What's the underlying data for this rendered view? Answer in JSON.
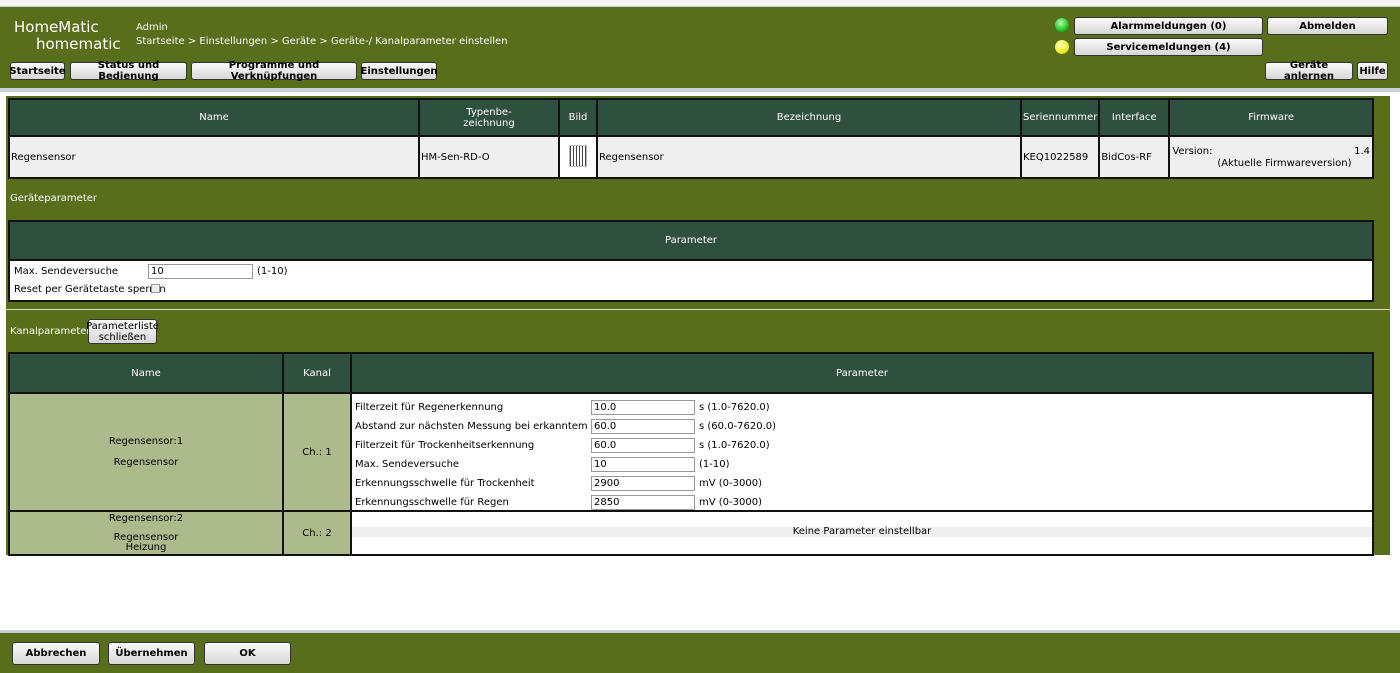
{
  "header": {
    "logo_top": "HomeMatic",
    "logo_bottom": "homematic",
    "user": "Admin",
    "breadcrumb": "Startseite > Einstellungen > Geräte > Geräte-/ Kanalparameter einstellen",
    "nav": [
      "Startseite",
      "Status und Bedienung",
      "Programme und Verknüpfungen",
      "Einstellungen"
    ],
    "alarm": "Alarmmeldungen (0)",
    "service": "Servicemeldungen (4)",
    "logout": "Abmelden",
    "learn": "Geräte anlernen",
    "help": "Hilfe",
    "colors": {
      "alarm_led": "#22c022",
      "service_led": "#f0f020",
      "green": "#586e1b",
      "table_header": "#30503f"
    }
  },
  "device": {
    "headers": [
      "Name",
      "Typenbe-\nzeichnung",
      "Bild",
      "Bezeichnung",
      "Seriennummer",
      "Interface",
      "Firmware"
    ],
    "name": "Regensensor",
    "type": "HM-Sen-RD-O",
    "description": "Regensensor",
    "serial": "KEQ1022589",
    "interface": "BidCos-RF",
    "fw_label": "Version:",
    "fw_version": "1.4",
    "fw_note": "(Aktuelle Firmwareversion)"
  },
  "device_params": {
    "title": "Geräteparameter",
    "header": "Parameter",
    "max_send_label": "Max. Sendeversuche",
    "max_send_value": "10",
    "max_send_range": "(1-10)",
    "reset_label": "Reset per Gerätetaste sperren",
    "reset_checked": false
  },
  "channel_params": {
    "title": "Kanalparameter",
    "close_button": "Parameterliste schließen",
    "headers": [
      "Name",
      "Kanal",
      "Parameter"
    ],
    "channels": [
      {
        "name": "Regensensor:1",
        "desc": "Regensensor",
        "kanal": "Ch.: 1",
        "params": [
          {
            "label": "Filterzeit für Regenerkennung",
            "value": "10.0",
            "range": "s (1.0-7620.0)"
          },
          {
            "label": "Abstand zur nächsten Messung bei erkanntem Regen",
            "value": "60.0",
            "range": "s (60.0-7620.0)"
          },
          {
            "label": "Filterzeit für Trockenheitserkennung",
            "value": "60.0",
            "range": "s (1.0-7620.0)"
          },
          {
            "label": "Max. Sendeversuche",
            "value": "10",
            "range": "(1-10)"
          },
          {
            "label": "Erkennungsschwelle für Trockenheit",
            "value": "2900",
            "range": "mV (0-3000)"
          },
          {
            "label": "Erkennungsschwelle für Regen",
            "value": "2850",
            "range": "mV (0-3000)"
          }
        ]
      },
      {
        "name": "Regensensor:2",
        "desc": "Regensensor",
        "desc2": "Heizung",
        "kanal": "Ch.: 2",
        "none": "Keine Parameter einstellbar"
      }
    ]
  },
  "footer": {
    "cancel": "Abbrechen",
    "apply": "Übernehmen",
    "ok": "OK"
  }
}
